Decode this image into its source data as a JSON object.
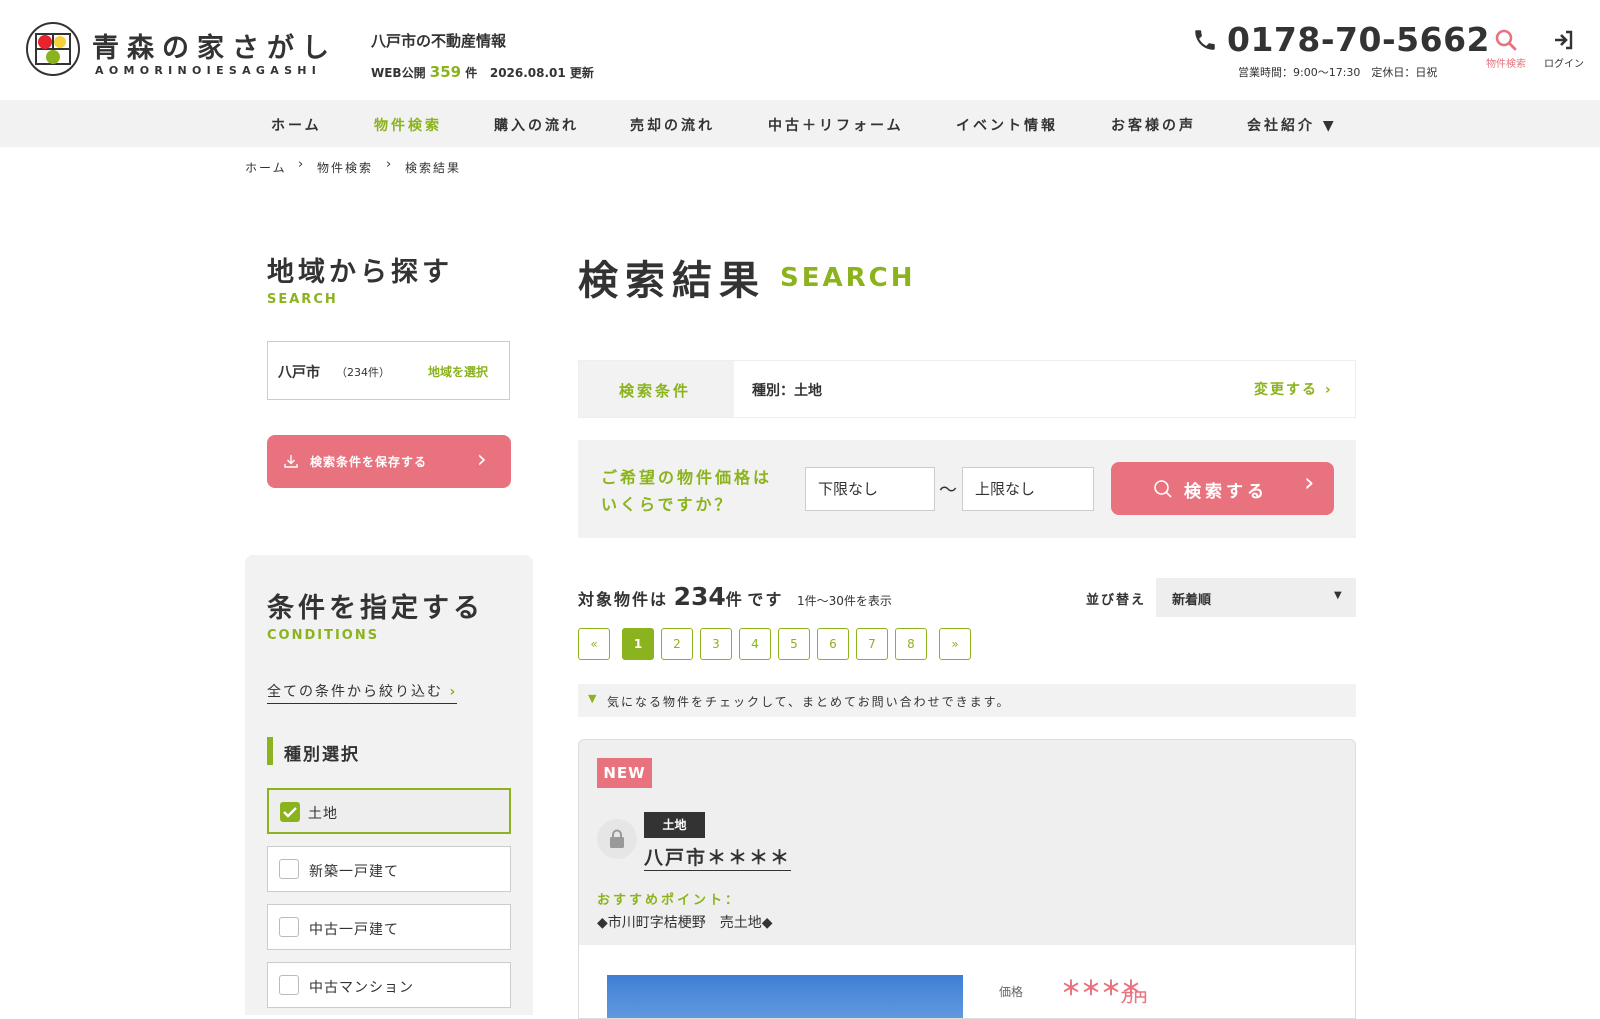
{
  "header": {
    "logo_title": "青森の家さがし",
    "logo_sub": "AOMORINOIESAGASHI",
    "tagline": "八戸市の不動産情報",
    "web_prefix": "WEB公開",
    "web_count": "359",
    "web_unit": "件",
    "updated": "2026.08.01 更新",
    "phone": "0178-70-5662",
    "hours": "営業時間：9:00〜17:30　定休日：日祝",
    "search_icon_label": "物件検索",
    "login_icon_label": "ログイン"
  },
  "nav": {
    "items": [
      {
        "label": "ホーム"
      },
      {
        "label": "物件検索"
      },
      {
        "label": "購入の流れ"
      },
      {
        "label": "売却の流れ"
      },
      {
        "label": "中古＋リフォーム"
      },
      {
        "label": "イベント情報"
      },
      {
        "label": "お客様の声"
      },
      {
        "label": "会社紹介 ▼"
      }
    ]
  },
  "breadcrumb": {
    "items": [
      "ホーム",
      "物件検索",
      "検索結果"
    ]
  },
  "sidebar": {
    "region_title": "地域から探す",
    "region_en": "SEARCH",
    "region_name": "八戸市",
    "region_count": "（234件）",
    "region_select": "地域を選択",
    "save_label": "検索条件を保存する",
    "cond_title": "条件を指定する",
    "cond_en": "CONDITIONS",
    "all_filter": "全ての条件から絞り込む",
    "type_heading": "種別選択",
    "types": [
      {
        "label": "土地",
        "checked": true
      },
      {
        "label": "新築一戸建て",
        "checked": false
      },
      {
        "label": "中古一戸建て",
        "checked": false
      },
      {
        "label": "中古マンション",
        "checked": false
      }
    ]
  },
  "main": {
    "title": "検索結果",
    "title_en": "SEARCH",
    "cond_label": "検索条件",
    "cond_value": "種別：土地",
    "cond_change": "変更する",
    "price_question_1": "ご希望の物件価格は",
    "price_question_2": "いくらですか？",
    "price_min": "下限なし",
    "price_sep": "〜",
    "price_max": "上限なし",
    "search_label": "検索する",
    "count_prefix": "対象物件は",
    "count": "234",
    "count_unit": "件",
    "count_suffix": "です",
    "range": "1件〜30件を表示",
    "sort_label": "並び替え",
    "sort_value": "新着順",
    "pages": [
      "«",
      "1",
      "2",
      "3",
      "4",
      "5",
      "6",
      "7",
      "8",
      "»"
    ],
    "current_page": "1",
    "notice": "気になる物件をチェックして、まとめてお問い合わせできます。"
  },
  "listing": {
    "badge": "NEW",
    "type": "土地",
    "name": "八戸市＊＊＊＊",
    "point_label": "おすすめポイント：",
    "point_text": "◆市川町字桔梗野　売土地◆",
    "price_label": "価格",
    "price_value": "＊＊＊＊",
    "price_unit": "万円"
  },
  "colors": {
    "accent_green": "#8bb31d",
    "accent_pink": "#e8737e",
    "text": "#333333",
    "panel_gray": "#f2f2f2"
  }
}
